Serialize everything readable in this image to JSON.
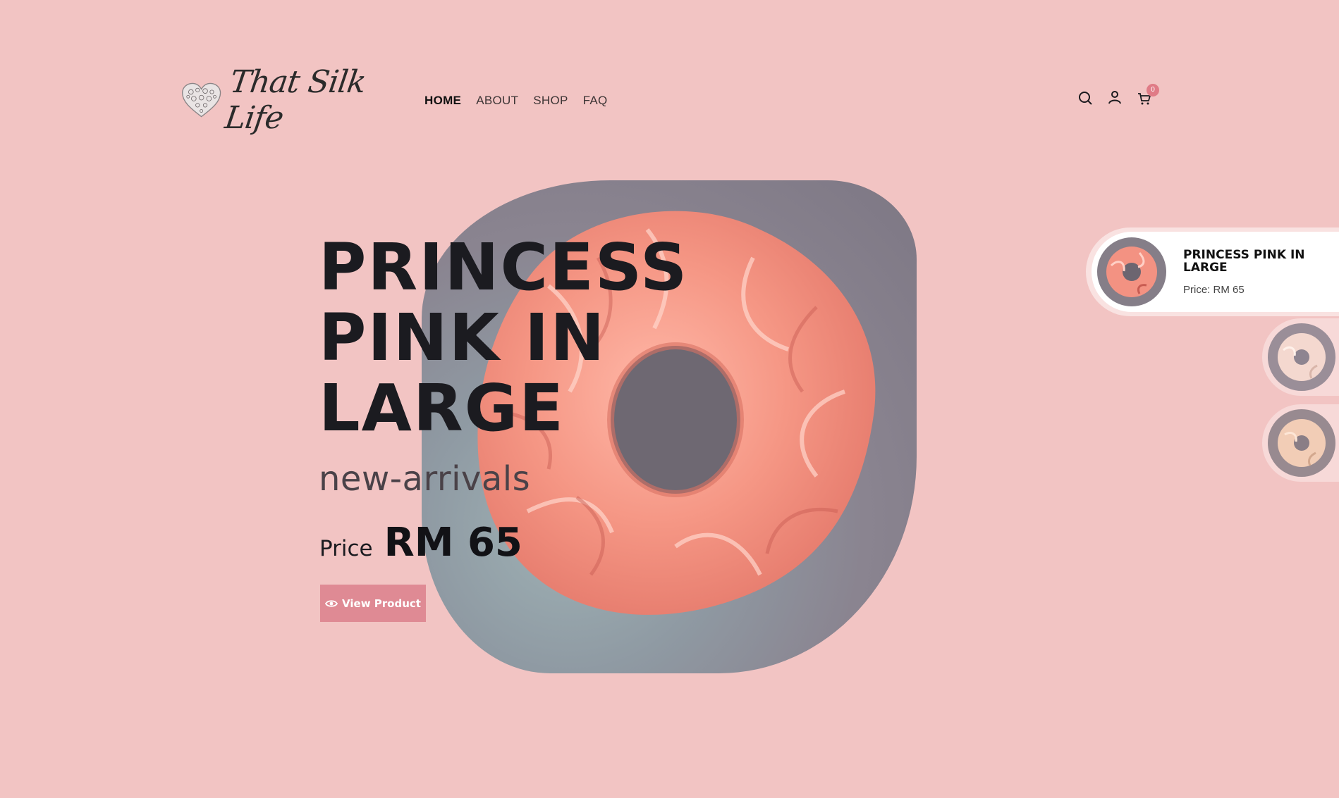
{
  "brand": {
    "name": "That Silk Life",
    "logo_icon": "heart-lace-icon"
  },
  "nav": [
    {
      "label": "HOME",
      "active": true
    },
    {
      "label": "ABOUT",
      "active": false
    },
    {
      "label": "SHOP",
      "active": false
    },
    {
      "label": "FAQ",
      "active": false
    }
  ],
  "header_icons": {
    "search": "search-icon",
    "account": "user-icon",
    "cart": "cart-icon",
    "cart_count": "0"
  },
  "hero": {
    "title": "PRINCESS PINK IN LARGE",
    "subtitle": "new-arrivals",
    "price_label": "Price",
    "price_value": "RM 65",
    "button_label": "View Product",
    "button_icon": "eye-icon"
  },
  "slider": {
    "active": {
      "title": "PRINCESS PINK IN LARGE",
      "price": "Price: RM 65"
    },
    "others": [
      {
        "name": "scrunchie-thumbnail"
      },
      {
        "name": "scrunchie-thumbnail"
      }
    ]
  },
  "colors": {
    "background": "#f2c4c3",
    "accent": "#df8a94",
    "text": "#1b1b20"
  }
}
